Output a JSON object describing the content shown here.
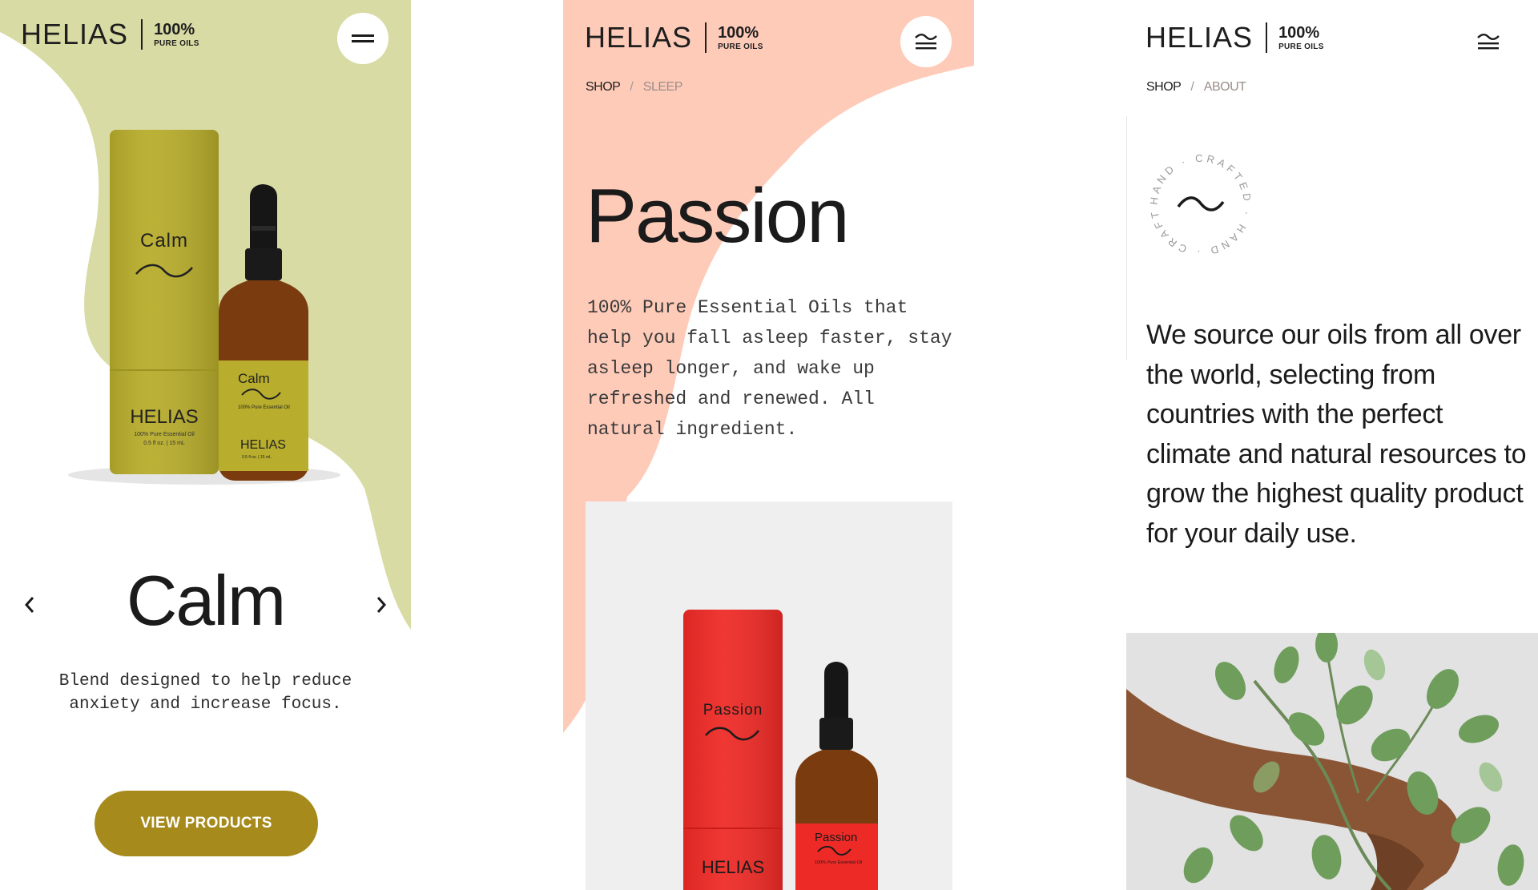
{
  "colors": {
    "calm_bg": "#d9dba4",
    "calm_accent": "#a68a1b",
    "passion_bg": "#ffcbb9",
    "passion_product": "#ee2a26",
    "text": "#1b1b1b"
  },
  "brand": {
    "wordmark": "HELIAS",
    "percent": "100%",
    "tagline": "PURE OILS"
  },
  "screen1": {
    "menu_icon": "hamburger-icon",
    "product_box_label": "Calm",
    "box_brand": "HELIAS",
    "box_fine_print_1": "100% Pure Essential Oil",
    "box_fine_print_2": "0.5 fl oz. | 15 mL",
    "bottle_label": "Calm",
    "bottle_fine_print_1": "100% Pure Essential Oil",
    "bottle_brand": "HELIAS",
    "bottle_fine_print_2": "0.5 fl oz. | 15 mL",
    "title": "Calm",
    "description": "Blend designed to help reduce anxiety and increase focus.",
    "cta_label": "VIEW PRODUCTS",
    "prev_icon": "chevron-left-icon",
    "next_icon": "chevron-right-icon"
  },
  "screen2": {
    "breadcrumb": [
      "SHOP",
      "SLEEP"
    ],
    "breadcrumb_separator": "/",
    "title": "Passion",
    "description": "100% Pure Essential Oils that help you fall asleep faster, stay asleep longer, and wake up refreshed and renewed. All natural ingredient.",
    "product_box_label": "Passion",
    "box_brand": "HELIAS",
    "bottle_label": "Passion",
    "bottle_fine_print": "100% Pure Essential Oil",
    "menu_icon": "wave-menu-icon"
  },
  "screen3": {
    "breadcrumb": [
      "SHOP",
      "ABOUT"
    ],
    "breadcrumb_separator": "/",
    "badge_text": "HAND · CRAFTED · HAND · CRAFTED ·",
    "badge_icon": "wave-icon",
    "body": "We source our oils from all over the world, selecting from countries with the perfect climate and natural resources to grow the highest quality product for your daily use.",
    "menu_icon": "wave-menu-icon",
    "photo_icon": "eucalyptus-hand-photo"
  }
}
